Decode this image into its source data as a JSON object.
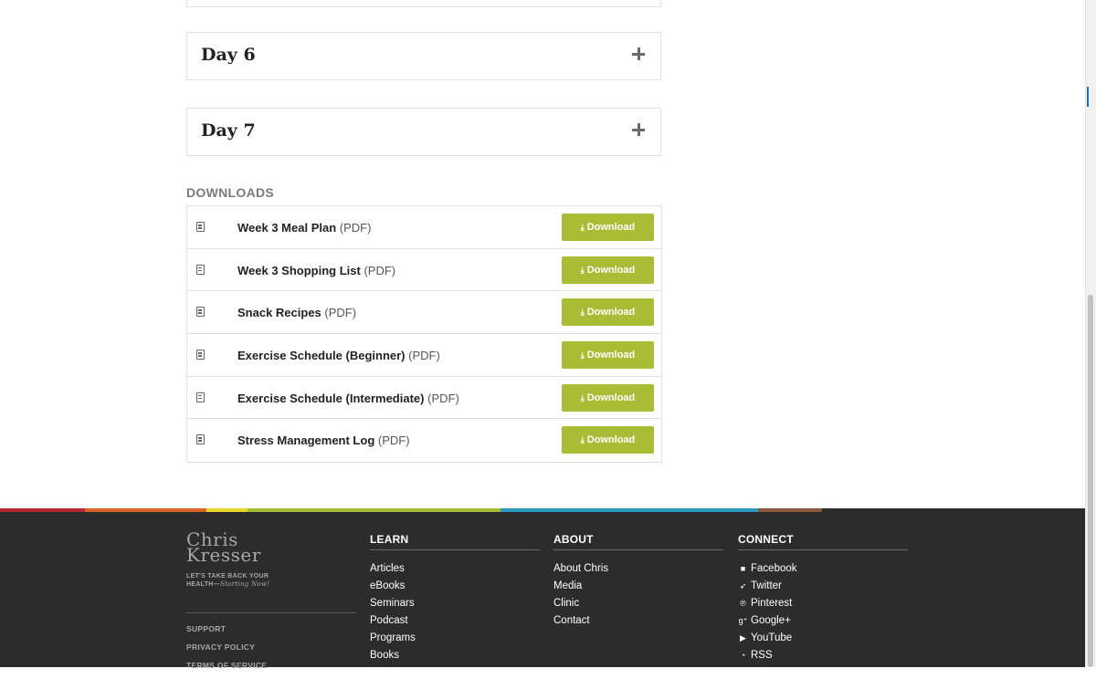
{
  "accordion": [
    {
      "title": "Day 6"
    },
    {
      "title": "Day 7"
    }
  ],
  "downloads": {
    "heading": "DOWNLOADS",
    "button_label": "Download",
    "items": [
      {
        "name": "Week 3 Meal Plan",
        "type": "(PDF)"
      },
      {
        "name": "Week 3 Shopping List",
        "type": "(PDF)"
      },
      {
        "name": "Snack Recipes",
        "type": "(PDF)"
      },
      {
        "name": "Exercise Schedule (Beginner)",
        "type": "(PDF)"
      },
      {
        "name": "Exercise Schedule (Intermediate)",
        "type": "(PDF)"
      },
      {
        "name": "Stress Management Log",
        "type": "(PDF)"
      }
    ]
  },
  "colors": {
    "accent_green": "#a8bc35",
    "footer_bg": "#2c2c2c",
    "stripe": [
      "#b5272d",
      "#d9632a",
      "#e8d62a",
      "#a3bd36",
      "#2d9ac4",
      "#8a5a3a"
    ]
  },
  "footer": {
    "brand": {
      "name_line1": "Chris",
      "name_line2": "Kresser",
      "tagline_line1": "LET'S TAKE BACK YOUR",
      "tagline_line2": "HEALTH—",
      "tagline_italic": "Starting Now!"
    },
    "legal_links": [
      "SUPPORT",
      "PRIVACY POLICY",
      "TERMS OF SERVICE"
    ],
    "learn": {
      "heading": "LEARN",
      "items": [
        "Articles",
        "eBooks",
        "Seminars",
        "Podcast",
        "Programs",
        "Books"
      ]
    },
    "about": {
      "heading": "ABOUT",
      "items": [
        "About Chris",
        "Media",
        "Clinic",
        "Contact"
      ]
    },
    "connect": {
      "heading": "CONNECT",
      "items": [
        {
          "label": "Facebook",
          "icon": "facebook-icon"
        },
        {
          "label": "Twitter",
          "icon": "twitter-icon"
        },
        {
          "label": "Pinterest",
          "icon": "pinterest-icon"
        },
        {
          "label": "Google+",
          "icon": "google-plus-icon"
        },
        {
          "label": "YouTube",
          "icon": "youtube-icon"
        },
        {
          "label": "RSS",
          "icon": "rss-icon"
        }
      ]
    }
  }
}
